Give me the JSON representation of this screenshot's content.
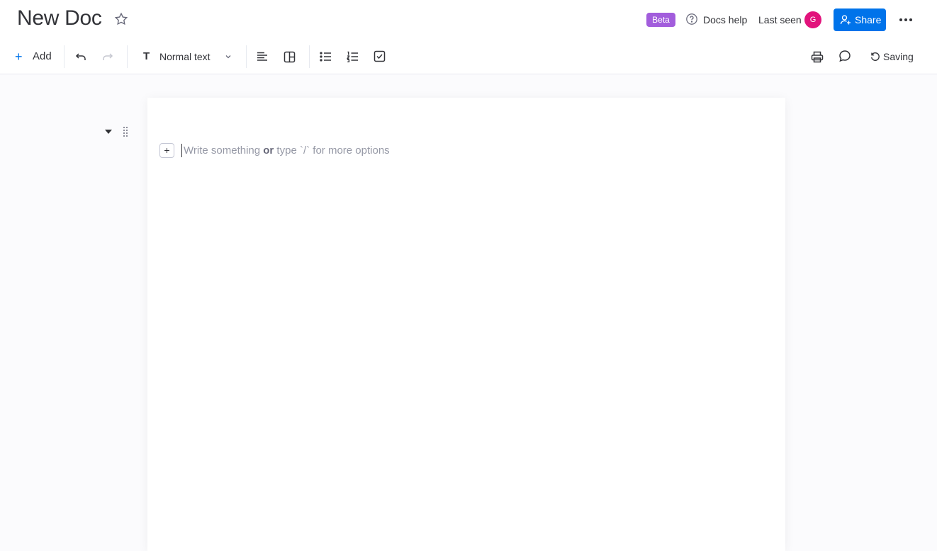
{
  "header": {
    "title": "New Doc",
    "star_icon": "star-icon",
    "beta_badge": "Beta",
    "help_label": "Docs help",
    "last_seen_label": "Last seen",
    "avatar_initial": "G",
    "share_label": "Share",
    "more_icon": "more-horizontal-icon"
  },
  "toolbar": {
    "add_label": "Add",
    "text_style_icon": "T",
    "text_style_value": "Normal text",
    "saving_label": "Saving"
  },
  "editor": {
    "placeholder_part1": "Write something ",
    "placeholder_bold": "or",
    "placeholder_part2": " type `/` for more options",
    "add_block_glyph": "+"
  },
  "colors": {
    "accent": "#0073ea",
    "beta_badge": "#a25ddc",
    "avatar": "#e2137c"
  }
}
